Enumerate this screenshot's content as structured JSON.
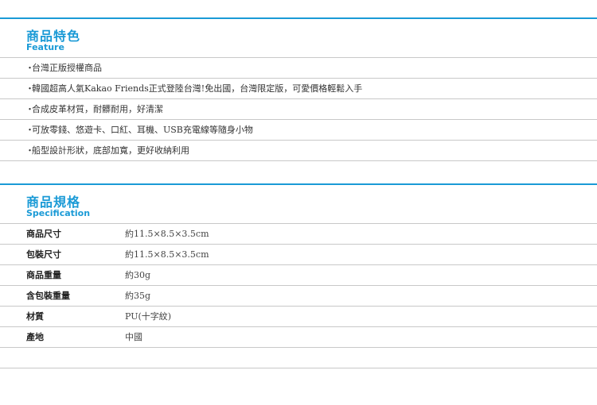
{
  "feature": {
    "title_zh": "商品特色",
    "title_en": "Feature",
    "bullet": "・",
    "items": [
      "台灣正版授權商品",
      "韓國超高人氣Kakao Friends正式登陸台灣!免出國，台灣限定版，可愛價格輕鬆入手",
      "合成皮革材質，耐髒耐用，好清潔",
      "可放零錢、悠遊卡、口紅、耳機、USB充電線等隨身小物",
      "船型設計形狀，底部加寬，更好收納利用"
    ]
  },
  "spec": {
    "title_zh": "商品規格",
    "title_en": "Specification",
    "rows": [
      {
        "label": "商品尺寸",
        "value": "約11.5×8.5×3.5cm"
      },
      {
        "label": "包裝尺寸",
        "value": "約11.5×8.5×3.5cm"
      },
      {
        "label": "商品重量",
        "value": "約30g"
      },
      {
        "label": "含包裝重量",
        "value": "約35g"
      },
      {
        "label": "材質",
        "value": "PU(十字紋)"
      },
      {
        "label": "產地",
        "value": "中國"
      }
    ]
  },
  "colors": {
    "accent": "#1a9ad6",
    "rule": "#c8c8c8"
  }
}
